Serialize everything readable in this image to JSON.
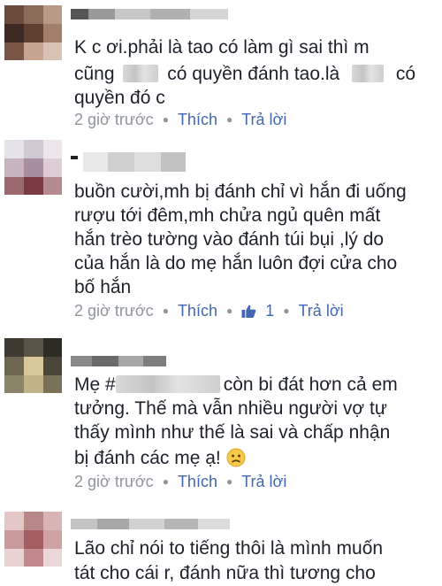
{
  "comments": [
    {
      "line1": "K c ơi.phải là tao có làm gì sai thì m",
      "line2_a": "cũng",
      "line2_b": "có quyền đánh tao.là",
      "line2_c": "có",
      "line3": "quyền đó c",
      "time": "2 giờ trước",
      "like": "Thích",
      "reply": "Trả lời"
    },
    {
      "lines": [
        "buồn cười,mh bị đánh chỉ vì hắn đi uống",
        "rượu tới đêm,mh chửa ngủ quên mất",
        "hắn trèo tường vào đánh túi bụi ,lý do",
        "của hắn là do mẹ hắn luôn đợi cửa cho",
        "bố hắn"
      ],
      "time": "2 giờ trước",
      "like": "Thích",
      "like_count": "1",
      "reply": "Trả lời"
    },
    {
      "line1_a": "Mẹ #",
      "line1_b": "còn  bi đát hơn cả em",
      "lines": [
        "tưởng. Thế mà vẫn nhiều người vợ tự",
        "thấy mình như thế là sai và chấp nhận",
        "bị đánh các mẹ ạ!"
      ],
      "time": "2 giờ trước",
      "like": "Thích",
      "reply": "Trả lời"
    },
    {
      "lines": [
        "Lão chỉ nói to tiếng thôi là mình muốn",
        "tát cho cái r, đánh nữa thì tương cho"
      ]
    }
  ],
  "colors": {
    "link": "#4267b2",
    "meta": "#90949c",
    "text": "#1d2129"
  },
  "icons": [
    "thumbs-up-icon",
    "sad-face-emoji"
  ]
}
